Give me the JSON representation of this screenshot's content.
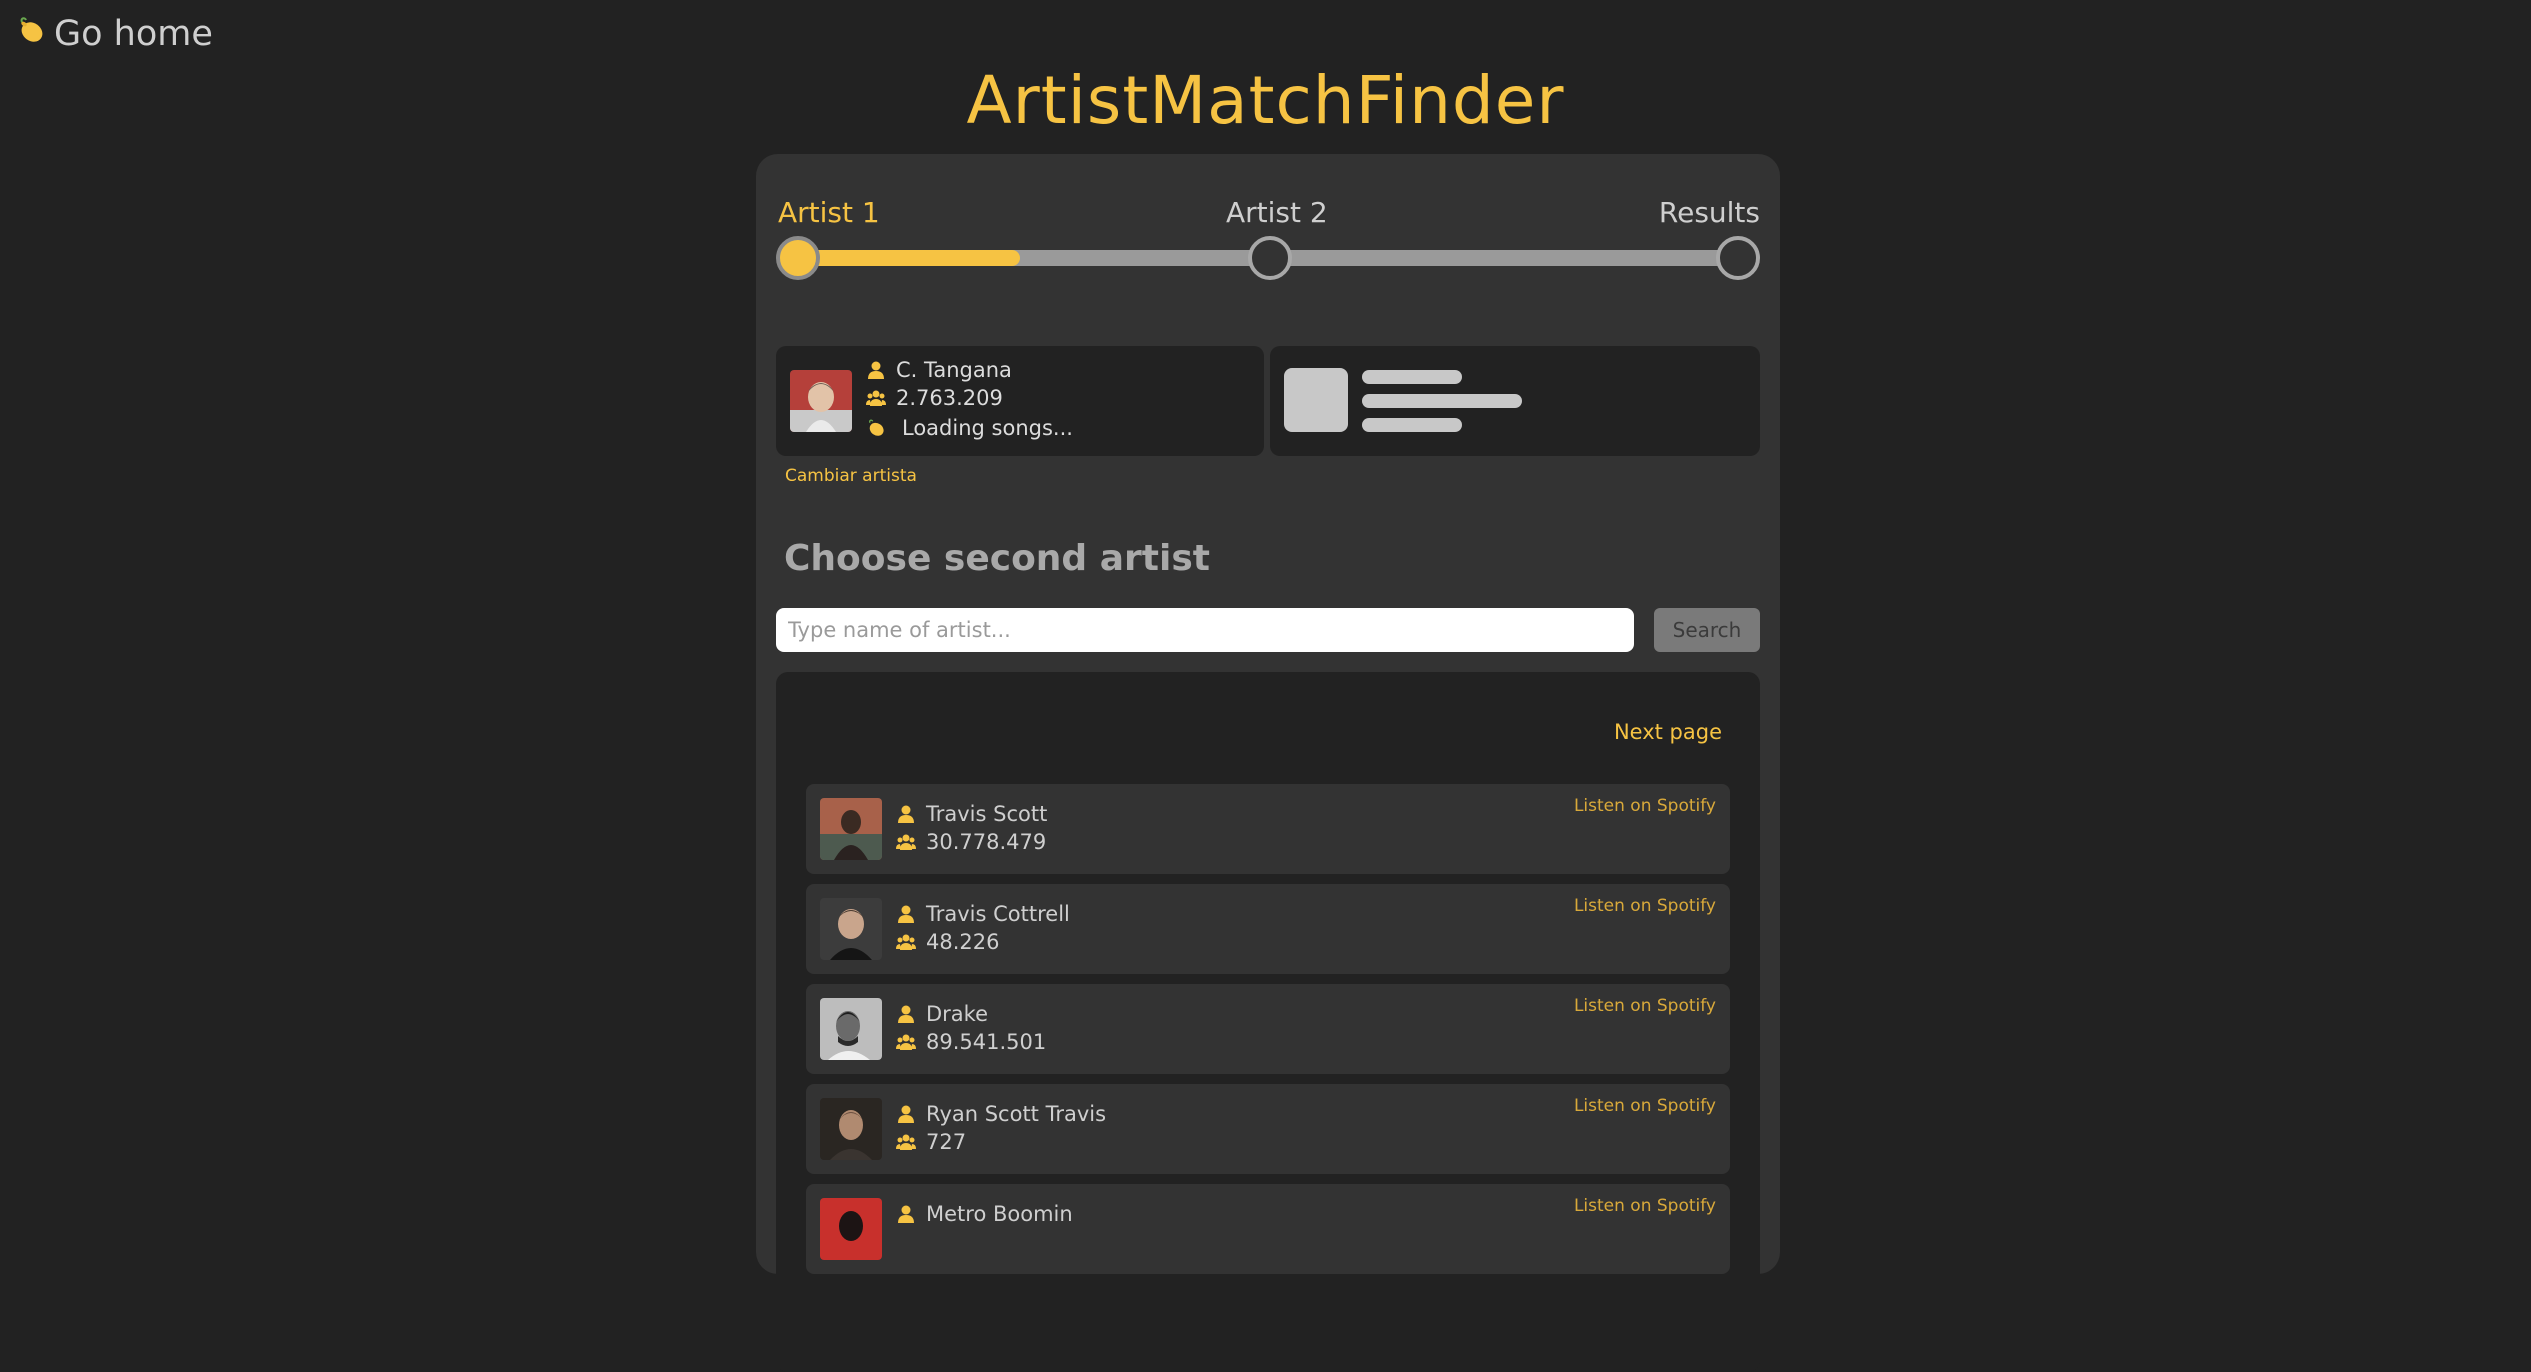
{
  "nav": {
    "go_home_label": "Go home"
  },
  "app_title": "ArtistMatchFinder",
  "stepper": {
    "steps": [
      "Artist 1",
      "Artist 2",
      "Results"
    ],
    "active_step": 0,
    "progress_first_segment": 0.47
  },
  "selected_artist": {
    "name": "C. Tangana",
    "followers": "2.763.209",
    "status": "Loading songs..."
  },
  "change_artist_label": "Cambiar artista",
  "section_title": "Choose second artist",
  "search": {
    "placeholder": "Type name of artist...",
    "value": "",
    "button_label": "Search"
  },
  "results": {
    "next_page_label": "Next page",
    "spotify_label": "Listen on Spotify",
    "items": [
      {
        "name": "Travis Scott",
        "followers": "30.778.479"
      },
      {
        "name": "Travis Cottrell",
        "followers": "48.226"
      },
      {
        "name": "Drake",
        "followers": "89.541.501"
      },
      {
        "name": "Ryan Scott Travis",
        "followers": "727"
      },
      {
        "name": "Metro Boomin",
        "followers": ""
      }
    ]
  },
  "colors": {
    "background": "#222222",
    "panel": "#333333",
    "accent": "#f6c343",
    "track": "#9a9a9a"
  },
  "icons": {
    "lemon": "lemon-icon",
    "user": "user-icon",
    "followers": "users-icon"
  }
}
